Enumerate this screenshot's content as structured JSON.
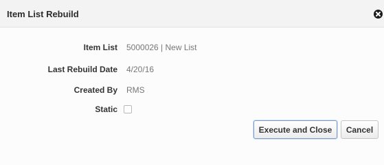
{
  "dialog": {
    "title": "Item List Rebuild",
    "close_icon": "close-circle-icon"
  },
  "fields": [
    {
      "label": "Item List",
      "value": "5000026 | New List"
    },
    {
      "label": "Last Rebuild Date",
      "value": "4/20/16"
    },
    {
      "label": "Created By",
      "value": "RMS"
    },
    {
      "label": "Static",
      "checked": false
    }
  ],
  "buttons": {
    "execute_close": "Execute and Close",
    "cancel": "Cancel"
  },
  "colors": {
    "title_bar": "#f3f3f3",
    "close_icon": "#1b1b1b",
    "primary_border": "#7c9cc4"
  }
}
